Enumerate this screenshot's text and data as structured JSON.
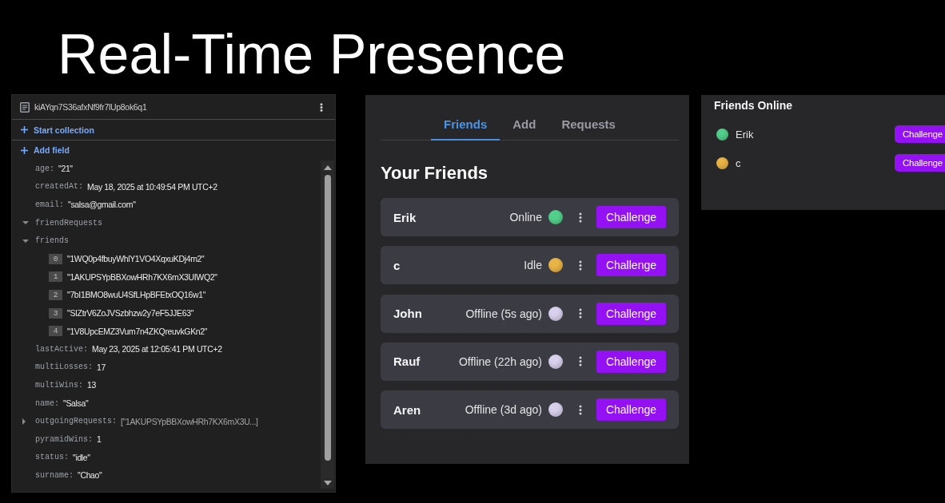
{
  "title": "Real-Time Presence",
  "document_panel": {
    "document_id": "kiAYqn7S36afxNf9fr7lUp8ok6q1",
    "actions": [
      "Start collection",
      "Add field"
    ],
    "fields": [
      {
        "kind": "value",
        "key": "age:",
        "value": "\"21\""
      },
      {
        "kind": "value",
        "key": "createdAt:",
        "value": "May 18, 2025 at 10:49:54 PM UTC+2"
      },
      {
        "kind": "value",
        "key": "email:",
        "value": "\"salsa@gmail.com\""
      },
      {
        "kind": "group",
        "key": "friendRequests",
        "expanded": true
      },
      {
        "kind": "group",
        "key": "friends",
        "expanded": true,
        "children": [
          {
            "index": "0",
            "value": "\"1WQ0p4fbuyWhlY1VO4XqxuKDj4m2\""
          },
          {
            "index": "1",
            "value": "\"1AKUPSYpBBXowHRh7KX6mX3UIWQ2\""
          },
          {
            "index": "2",
            "value": "\"7bI1BMO8wuU4SfLHpBFEtxOQ16w1\""
          },
          {
            "index": "3",
            "value": "\"SIZtrV6ZoJVSzbhzw2y7eF5JJE63\""
          },
          {
            "index": "4",
            "value": "\"1V8UpcEMZ3Vum7n4ZKQreuvkGKn2\""
          }
        ]
      },
      {
        "kind": "value",
        "key": "lastActive:",
        "value": "May 23, 2025 at 12:05:41 PM UTC+2"
      },
      {
        "kind": "value",
        "key": "multiLosses:",
        "value": "17"
      },
      {
        "kind": "value",
        "key": "multiWins:",
        "value": "13"
      },
      {
        "kind": "value",
        "key": "name:",
        "value": "\"Salsa\""
      },
      {
        "kind": "group",
        "key": "outgoingRequests:",
        "expanded": false,
        "value": "[\"1AKUPSYpBBXowHRh7KX6mX3U...]"
      },
      {
        "kind": "value",
        "key": "pyramidWins:",
        "value": "1"
      },
      {
        "kind": "value",
        "key": "status:",
        "value": "\"idle\""
      },
      {
        "kind": "value",
        "key": "surname:",
        "value": "\"Chao\""
      }
    ]
  },
  "friends_panel": {
    "tabs": [
      {
        "label": "Friends",
        "selected": true
      },
      {
        "label": "Add",
        "selected": false
      },
      {
        "label": "Requests",
        "selected": false
      }
    ],
    "heading": "Your Friends",
    "friends": [
      {
        "name": "Erik",
        "status": "Online",
        "color": "#52cf8a",
        "action": "Challenge"
      },
      {
        "name": "c",
        "status": "Idle",
        "color": "#e9b446",
        "action": "Challenge"
      },
      {
        "name": "John",
        "status": "Offline (5s ago)",
        "color": "#d8d0ec",
        "action": "Challenge"
      },
      {
        "name": "Rauf",
        "status": "Offline (22h ago)",
        "color": "#d8d0ec",
        "action": "Challenge"
      },
      {
        "name": "Aren",
        "status": "Offline (3d ago)",
        "color": "#d8d0ec",
        "action": "Challenge"
      }
    ]
  },
  "online_panel": {
    "title": "Friends Online",
    "friends": [
      {
        "name": "Erik",
        "color": "#52cf8a",
        "action": "Challenge"
      },
      {
        "name": "c",
        "color": "#e9b446",
        "action": "Challenge"
      }
    ]
  }
}
